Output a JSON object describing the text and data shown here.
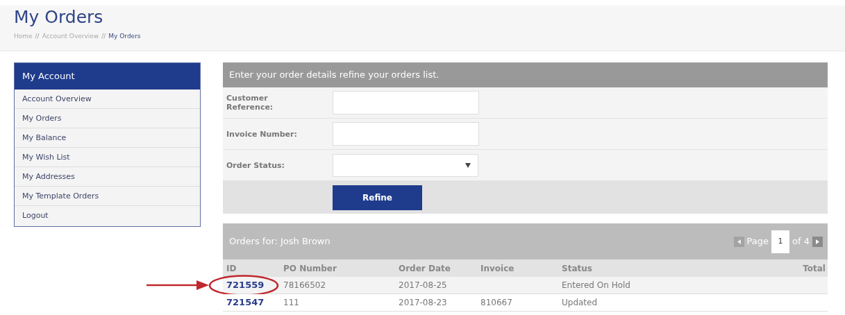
{
  "page_title": "My Orders",
  "breadcrumb": [
    {
      "label": "Home",
      "current": false
    },
    {
      "label": "Account Overview",
      "current": false
    },
    {
      "label": "My Orders",
      "current": true
    }
  ],
  "breadcrumb_separator": "//",
  "sidebar": {
    "title": "My Account",
    "items": [
      {
        "label": "Account Overview"
      },
      {
        "label": "My Orders"
      },
      {
        "label": "My Balance"
      },
      {
        "label": "My Wish List"
      },
      {
        "label": "My Addresses"
      },
      {
        "label": "My Template Orders"
      },
      {
        "label": "Logout"
      }
    ]
  },
  "filter": {
    "heading": "Enter your order details refine your orders list.",
    "fields": [
      {
        "label": "Customer Reference:",
        "kind": "text"
      },
      {
        "label": "Invoice Number:",
        "kind": "text"
      },
      {
        "label": "Order Status:",
        "kind": "select"
      }
    ],
    "button": "Refine"
  },
  "orders": {
    "heading": "Orders for: Josh Brown",
    "pager": {
      "label": "Page",
      "page": "1",
      "of": "of 4"
    },
    "columns": [
      "ID",
      "PO Number",
      "Order Date",
      "Invoice",
      "Status",
      "Total"
    ],
    "rows": [
      {
        "id": "721559",
        "po": "78166502",
        "date": "2017-08-25",
        "invoice": "",
        "status": "Entered On Hold",
        "highlighted": true
      },
      {
        "id": "721547",
        "po": "111",
        "date": "2017-08-23",
        "invoice": "810667",
        "status": "Updated",
        "highlighted": false
      }
    ]
  }
}
